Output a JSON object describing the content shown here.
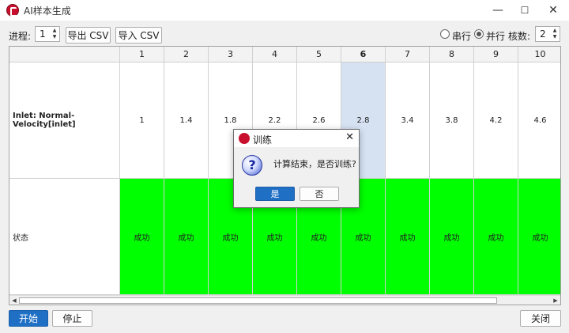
{
  "window": {
    "title": "AI样本生成",
    "minimize": "—",
    "maximize": "☐",
    "close": "✕"
  },
  "toolbar": {
    "process_label": "进程:",
    "process_value": "1",
    "export_csv": "导出 CSV",
    "import_csv": "导入 CSV",
    "serial_label": "串行",
    "parallel_label": "并行",
    "parallel_selected": true,
    "cores_label": "核数:",
    "cores_value": "2"
  },
  "table": {
    "columns": [
      "1",
      "2",
      "3",
      "4",
      "5",
      "6",
      "7",
      "8",
      "9",
      "10"
    ],
    "selected_column": "6",
    "rows": [
      {
        "header": "Inlet: Normal-Velocity[inlet]",
        "cells": [
          "1",
          "1.4",
          "1.8",
          "2.2",
          "2.6",
          "2.8",
          "3.4",
          "3.8",
          "4.2",
          "4.6"
        ]
      },
      {
        "header": "状态",
        "cells": [
          "成功",
          "成功",
          "成功",
          "成功",
          "成功",
          "成功",
          "成功",
          "成功",
          "成功",
          "成功"
        ]
      }
    ],
    "success_color": "#00ff00",
    "selected_color": "#d6e2f2"
  },
  "footer": {
    "start": "开始",
    "stop": "停止",
    "close": "关闭"
  },
  "dialog": {
    "title": "训练",
    "message": "计算结束，是否训练?",
    "yes": "是",
    "no": "否",
    "close": "✕",
    "icon": "question-icon"
  }
}
